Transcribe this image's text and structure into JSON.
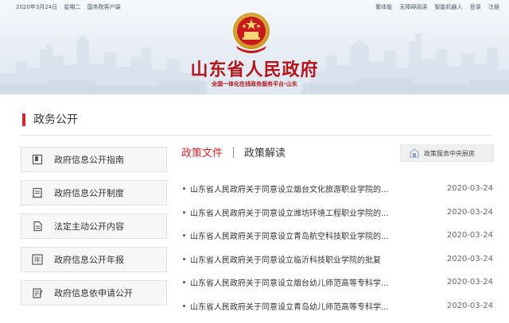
{
  "topbar": {
    "date": "2020年3月24日",
    "weekday": "星期二",
    "client": "国务院客户端",
    "links": [
      "繁体版",
      "无障碍阅读",
      "智能机器人",
      "登录",
      "注册"
    ]
  },
  "header": {
    "title": "山东省人民政府",
    "subtitle": "全国一体化在线政务服务平台·山东"
  },
  "section": {
    "title": "政务公开"
  },
  "sidebar": {
    "items": [
      {
        "label": "政府信息公开指南",
        "icon": "book-icon"
      },
      {
        "label": "政府信息公开制度",
        "icon": "document-list-icon"
      },
      {
        "label": "法定主动公开内容",
        "icon": "file-icon"
      },
      {
        "label": "政府信息公开年报",
        "icon": "year-icon"
      },
      {
        "label": "政府信息依申请公开",
        "icon": "edit-document-icon"
      }
    ]
  },
  "tabs": [
    {
      "label": "政策文件",
      "active": true
    },
    {
      "label": "政策解读",
      "active": false
    }
  ],
  "service_button": {
    "label": "政策服务中央厨房",
    "icon": "building-icon"
  },
  "news": [
    {
      "title": "山东省人民政府关于同意设立烟台文化旅游职业学院的...",
      "date": "2020-03-24"
    },
    {
      "title": "山东省人民政府关于同意设立潍坊环境工程职业学院的...",
      "date": "2020-03-24"
    },
    {
      "title": "山东省人民政府关于同意设立青岛航空科技职业学院的...",
      "date": "2020-03-24"
    },
    {
      "title": "山东省人民政府关于同意设立临沂科技职业学院的批复",
      "date": "2020-03-24"
    },
    {
      "title": "山东省人民政府关于同意设立烟台幼儿师范高等专科学...",
      "date": "2020-03-24"
    },
    {
      "title": "山东省人民政府关于同意设立青岛幼儿师范高等专科学...",
      "date": "2020-03-24"
    }
  ],
  "colors": {
    "accent": "#d4242b",
    "title_red": "#b3151b"
  }
}
